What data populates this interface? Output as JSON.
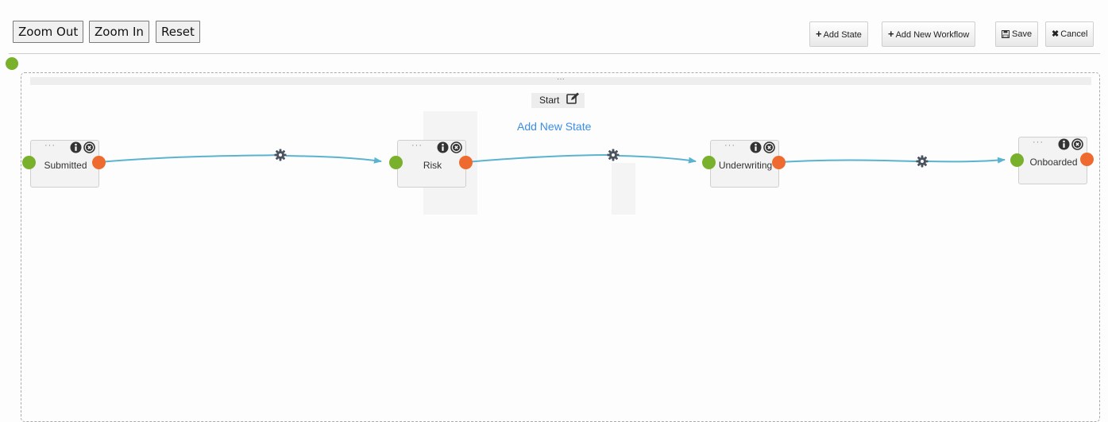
{
  "toolbar_left": {
    "zoom_out": "Zoom Out",
    "zoom_in": "Zoom In",
    "reset": "Reset"
  },
  "toolbar_right": {
    "add_state": "Add State",
    "add_new_workflow": "Add New Workflow",
    "save": "Save",
    "cancel": "Cancel"
  },
  "canvas": {
    "grip": "···",
    "start_label": "Start",
    "add_new_state": "Add New State"
  },
  "nodes": [
    {
      "label": "Submitted",
      "grip": "···"
    },
    {
      "label": "Risk",
      "grip": "···"
    },
    {
      "label": "Underwriting",
      "grip": "···"
    },
    {
      "label": "Onboarded",
      "grip": "···"
    }
  ],
  "colors": {
    "input_port": "#79b12d",
    "output_port": "#ee6a2f",
    "edge": "#5bb3d0",
    "link": "#3a8ee6",
    "icon_dark": "#333333"
  },
  "icons": {
    "plus": "plus-icon",
    "save": "floppy-disk-icon",
    "cancel": "close-icon",
    "edit": "edit-icon",
    "info": "info-icon",
    "remove": "remove-icon",
    "transition": "gear-icon"
  }
}
